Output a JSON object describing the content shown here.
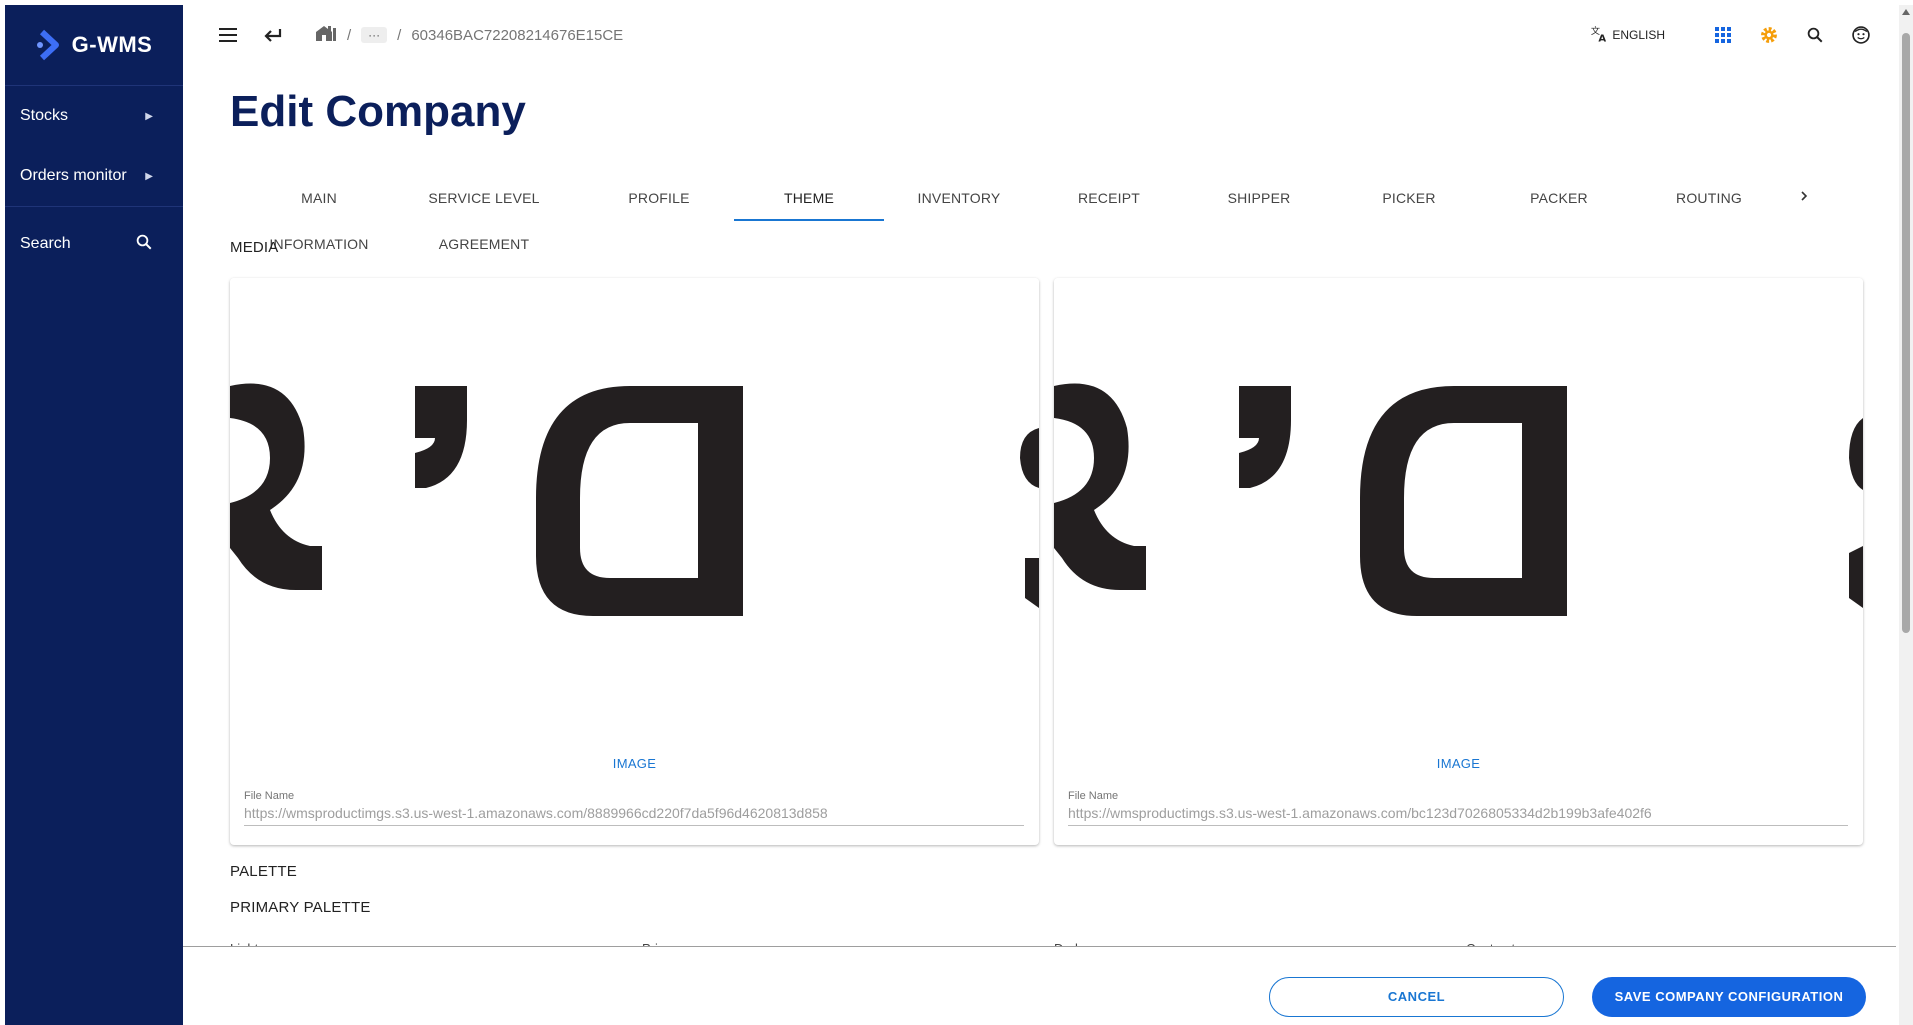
{
  "app": {
    "logo_text": "G-WMS"
  },
  "sidebar": {
    "items": [
      {
        "label": "Stocks",
        "icon": "chevron-right-icon"
      },
      {
        "label": "Orders monitor",
        "icon": "chevron-right-icon"
      },
      {
        "label": "Search",
        "icon": "search-icon"
      }
    ]
  },
  "header": {
    "breadcrumb": {
      "separator": "/",
      "collapsed": "···",
      "current": "60346BAC72208214676E15CE"
    },
    "language": "ENGLISH",
    "icons": [
      "menu-icon",
      "back-icon",
      "home-icon",
      "translate-icon",
      "apps-grid-icon",
      "settings-icon",
      "search-icon",
      "account-icon"
    ]
  },
  "page": {
    "title": "Edit Company",
    "tabs": [
      "MAIN INFORMATION",
      "SERVICE LEVEL AGREEMENT",
      "PROFILE",
      "THEME",
      "INVENTORY",
      "RECEIPT",
      "SHIPPER",
      "PICKER",
      "PACKER",
      "ROUTING"
    ],
    "active_tab": "THEME",
    "media_label": "MEDIA",
    "media_cards": [
      {
        "image_label": "IMAGE",
        "field_label": "File Name",
        "field_value": "https://wmsproductimgs.s3.us-west-1.amazonaws.com/8889966cd220f7da5f96d4620813d858"
      },
      {
        "image_label": "IMAGE",
        "field_label": "File Name",
        "field_value": "https://wmsproductimgs.s3.us-west-1.amazonaws.com/bc123d7026805334d2b199b3afe402f6"
      }
    ],
    "palette_label": "PALETTE",
    "primary_palette_label": "PRIMARY PALETTE",
    "palette_columns": [
      "Light",
      "Primary",
      "Dark",
      "Contrast"
    ]
  },
  "footer": {
    "cancel_label": "CANCEL",
    "save_label": "SAVE COMPANY CONFIGURATION"
  },
  "colors": {
    "sidebar_bg": "#0b1f5b",
    "accent": "#1976d2",
    "title": "#0b1f5b",
    "settings_icon": "#f59e0b",
    "apps_icon": "#1565e0"
  }
}
